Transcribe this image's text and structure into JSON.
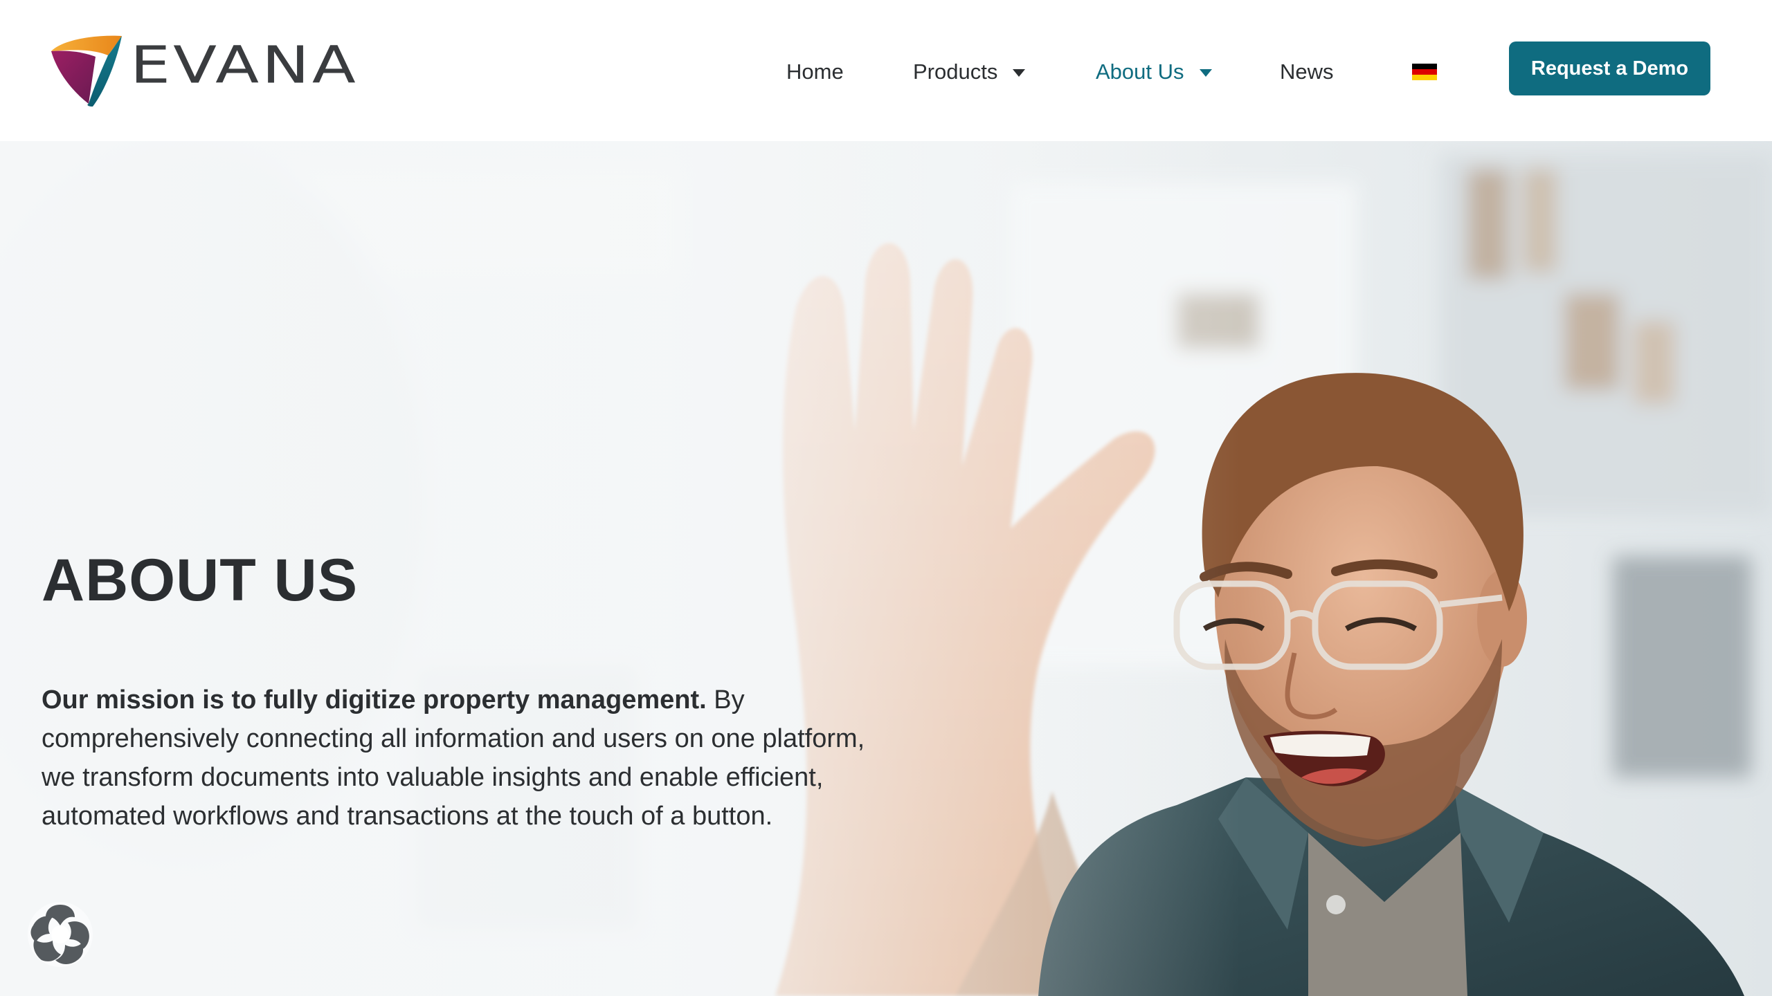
{
  "brand": {
    "name": "EVANA",
    "colors": {
      "orange": "#f39a1f",
      "purple": "#8b1d5c",
      "teal": "#0f6c80",
      "text": "#3a3c3f"
    }
  },
  "nav": {
    "items": [
      {
        "label": "Home",
        "has_dropdown": false,
        "active": false
      },
      {
        "label": "Products",
        "has_dropdown": true,
        "active": false
      },
      {
        "label": "About Us",
        "has_dropdown": true,
        "active": true
      },
      {
        "label": "News",
        "has_dropdown": false,
        "active": false
      }
    ],
    "language_icon": "german-flag-icon",
    "cta_label": "Request a Demo",
    "active_color": "#0f6c80"
  },
  "hero": {
    "title": "ABOUT US",
    "mission_bold": "Our mission is to fully digitize property management.",
    "mission_rest": " By comprehensively connecting all information and users on one platform, we transform documents into valuable insights and enable efficient, automated workflows and transactions at the touch of a button.",
    "image_icon": "smiling-man-high-five-photo"
  },
  "footer_widget": {
    "icon": "cookie-settings-icon"
  }
}
